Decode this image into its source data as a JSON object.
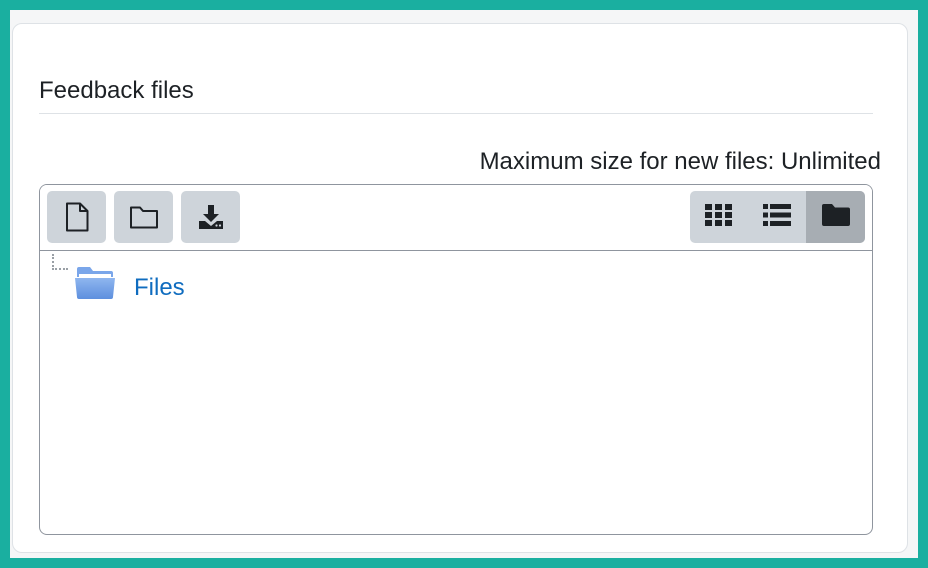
{
  "section": {
    "title": "Feedback files"
  },
  "filemanager": {
    "max_size_label": "Maximum size for new files: Unlimited",
    "toolbar": {
      "buttons": [
        {
          "name": "add-file-button",
          "icon": "file-icon"
        },
        {
          "name": "create-folder-button",
          "icon": "folder-outline-icon"
        },
        {
          "name": "download-button",
          "icon": "download-icon"
        }
      ],
      "views": [
        {
          "name": "view-icons-button",
          "icon": "grid-icon",
          "active": false
        },
        {
          "name": "view-details-button",
          "icon": "list-icon",
          "active": false
        },
        {
          "name": "view-tree-button",
          "icon": "folder-solid-icon",
          "active": true
        }
      ]
    },
    "tree": {
      "root_label": "Files",
      "root_icon": "folder-icon"
    }
  },
  "colors": {
    "frame": "#1aafa0",
    "link": "#0f6cbf",
    "button_bg": "#ced4da",
    "active_view_bg": "#a7adb3"
  }
}
